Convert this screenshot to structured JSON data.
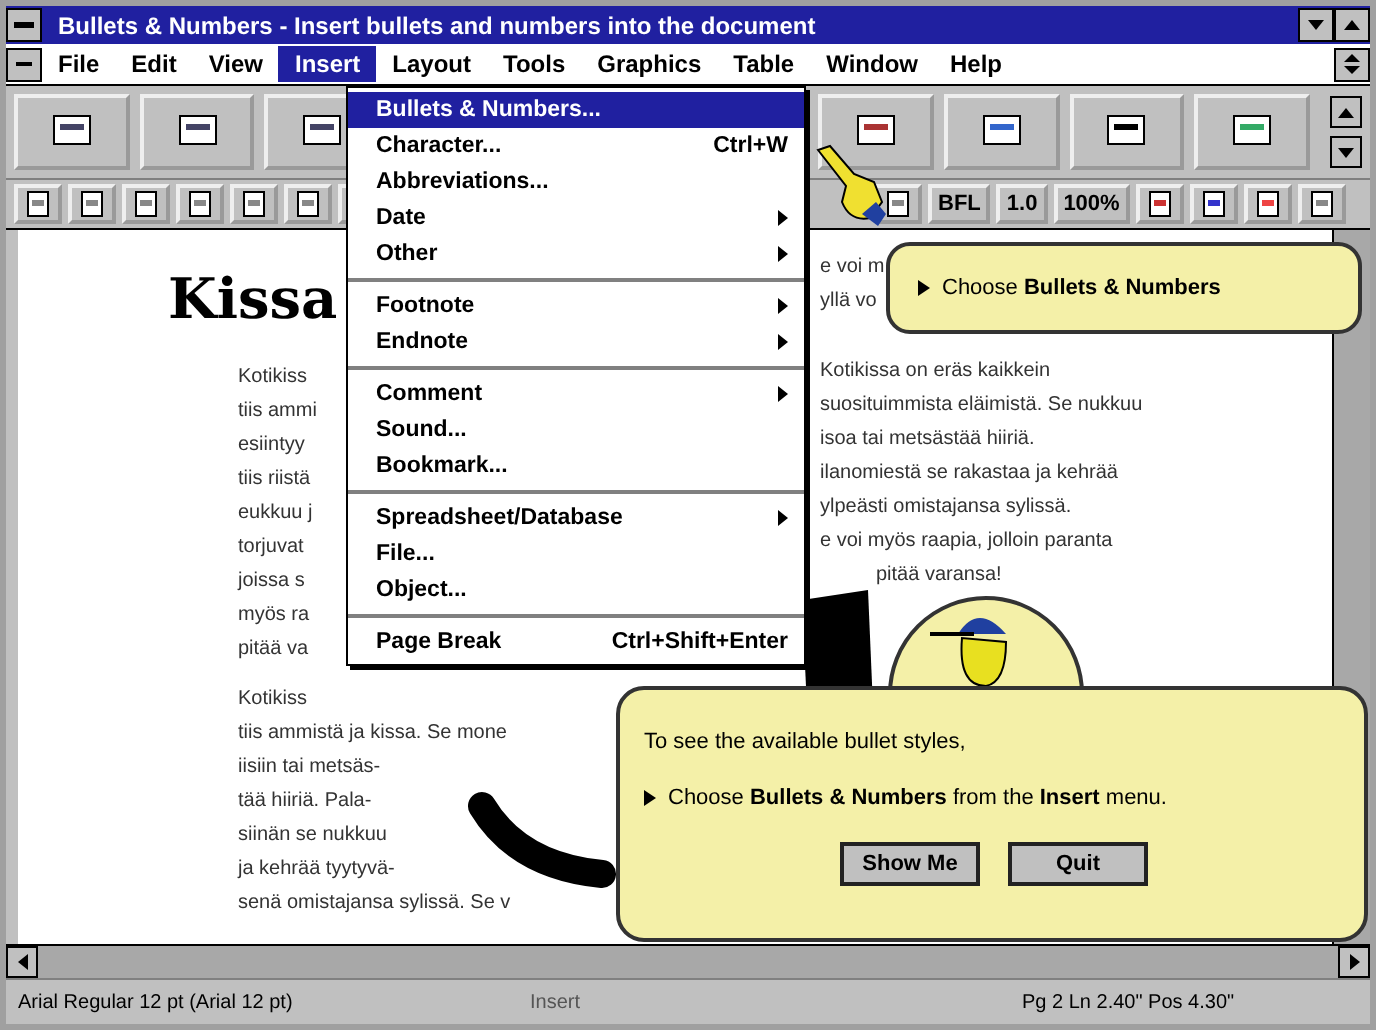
{
  "window": {
    "title": "Bullets & Numbers - Insert bullets and numbers into the document"
  },
  "menu_bar": [
    {
      "label": "File",
      "selected": false
    },
    {
      "label": "Edit",
      "selected": false
    },
    {
      "label": "View",
      "selected": false
    },
    {
      "label": "Insert",
      "selected": true
    },
    {
      "label": "Layout",
      "selected": false
    },
    {
      "label": "Tools",
      "selected": false
    },
    {
      "label": "Graphics",
      "selected": false
    },
    {
      "label": "Table",
      "selected": false
    },
    {
      "label": "Window",
      "selected": false
    },
    {
      "label": "Help",
      "selected": false
    }
  ],
  "insert_menu": [
    [
      {
        "label": "Bullets & Numbers...",
        "selected": true,
        "submenu": false
      },
      {
        "label": "Character...",
        "shortcut": "Ctrl+W",
        "selected": false,
        "submenu": false
      },
      {
        "label": "Abbreviations...",
        "selected": false,
        "submenu": false
      },
      {
        "label": "Date",
        "selected": false,
        "submenu": true
      },
      {
        "label": "Other",
        "selected": false,
        "submenu": true
      }
    ],
    [
      {
        "label": "Footnote",
        "selected": false,
        "submenu": true
      },
      {
        "label": "Endnote",
        "selected": false,
        "submenu": true
      }
    ],
    [
      {
        "label": "Comment",
        "selected": false,
        "submenu": true
      },
      {
        "label": "Sound...",
        "selected": false,
        "submenu": false
      },
      {
        "label": "Bookmark...",
        "selected": false,
        "submenu": false
      }
    ],
    [
      {
        "label": "Spreadsheet/Database",
        "selected": false,
        "submenu": true
      },
      {
        "label": "File...",
        "selected": false,
        "submenu": false
      },
      {
        "label": "Object...",
        "selected": false,
        "submenu": false
      }
    ],
    [
      {
        "label": "Page Break",
        "shortcut": "Ctrl+Shift+Enter",
        "selected": false,
        "submenu": false
      }
    ]
  ],
  "power_bar": [
    "BFL",
    "1.0",
    "100%"
  ],
  "document": {
    "title": "Kissa",
    "left_column": [
      [
        "Kotikiss",
        "tiis ammi",
        "esiintyy",
        "tiis riistä",
        "eukkuu j",
        "torjuvat",
        "joissa s",
        "myös ra",
        "pitää va"
      ],
      [
        "Kotikiss",
        "tiis ammistä ja kissa. Se mone",
        "iisiin tai metsäs-",
        "tää hiiriä. Pala-",
        "siinän se nukkuu",
        "ja kehrää tyytyvä-",
        "senä omistajansa sylissä. Se v"
      ]
    ],
    "right_column": [
      [
        "e voi m",
        "yllä vo"
      ],
      [
        "Kotikissa on eräs kaikkein",
        "suosituimmista eläimistä. Se nukkuu",
        "isoa tai metsästää hiiriä.",
        "ilanomiestä se rakastaa ja kehrää",
        "ylpeästi omistajansa sylissä.",
        "e voi myös raapia, jolloin paranta",
        "pitää varansa!"
      ]
    ]
  },
  "coach_tip": "Choose **Bullets & Numbers**",
  "coach": {
    "intro": "To see the available bullet styles,",
    "step": "Choose **Bullets & Numbers** from the **Insert** menu.",
    "buttons": [
      "Show Me",
      "Quit"
    ]
  },
  "status_bar": {
    "font": "Arial Regular 12 pt (Arial 12 pt)",
    "mode": "Insert",
    "position": "Pg 2 Ln 2.40\" Pos 4.30\""
  }
}
